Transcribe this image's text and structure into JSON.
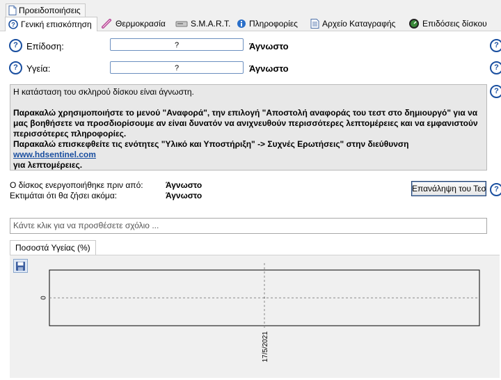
{
  "alerts_tab": {
    "label": "Προειδοποιήσεις",
    "icon": "page-icon"
  },
  "tabs": [
    {
      "label": "Γενική επισκόπηση",
      "icon": "help-circle-icon",
      "active": true
    },
    {
      "label": "Θερμοκρασία",
      "icon": "thermometer-icon",
      "active": false
    },
    {
      "label": "S.M.A.R.T.",
      "icon": "disk-icon",
      "active": false
    },
    {
      "label": "Πληροφορίες",
      "icon": "info-icon",
      "active": false
    },
    {
      "label": "Αρχείο Καταγραφής",
      "icon": "log-icon",
      "active": false
    },
    {
      "label": "Επιδόσεις δίσκου",
      "icon": "gauge-icon",
      "active": false
    }
  ],
  "performance": {
    "label": "Επίδοση:",
    "value": "?",
    "status": "Άγνωστο"
  },
  "health": {
    "label": "Υγεία:",
    "value": "?",
    "status": "Άγνωστο"
  },
  "info": {
    "line1": "Η κατάσταση του σκληρού δίσκου είναι άγνωστη.",
    "line2": "Παρακαλώ χρησιμοποιήστε το μενού \"Αναφορά\", την επιλογή \"Αποστολή αναφοράς του τεστ στο δημιουργό\" για να μας βοηθήσετε να προσδιορίσουμε αν είναι δυνατόν να ανιχνευθούν περισσότερες λεπτομέρειες και να εμφανιστούν περισσότερες πληροφορίες.",
    "line3_prefix": "Παρακαλώ επισκεφθείτε τις ενότητες \"Υλικό και Υποστήριξη\" -> Συχνές Ερωτήσεις\" στην διεύθυνση ",
    "link": "www.hdsentinel.com",
    "line3_suffix": "για λεπτομέρειες."
  },
  "powered_on": {
    "label": "Ο δίσκος ενεργοποιήθηκε πριν από:",
    "value": "Άγνωστο"
  },
  "remaining": {
    "label": "Εκτιμάται ότι θα ζήσει ακόμα:",
    "value": "Άγνωστο"
  },
  "repeat_button": "Επανάληψη του Τεστ",
  "comment_placeholder": "Κάντε κλικ για να προσθέσετε σχόλιο ...",
  "chart_tab": "Ποσοστά Υγείας (%)",
  "chart_data": {
    "type": "line",
    "x": [
      "17/5/2021"
    ],
    "series": [
      {
        "values": [
          0
        ]
      }
    ],
    "ylabel": "",
    "xlabel": "",
    "yticks": [
      "0"
    ],
    "grid": true
  }
}
